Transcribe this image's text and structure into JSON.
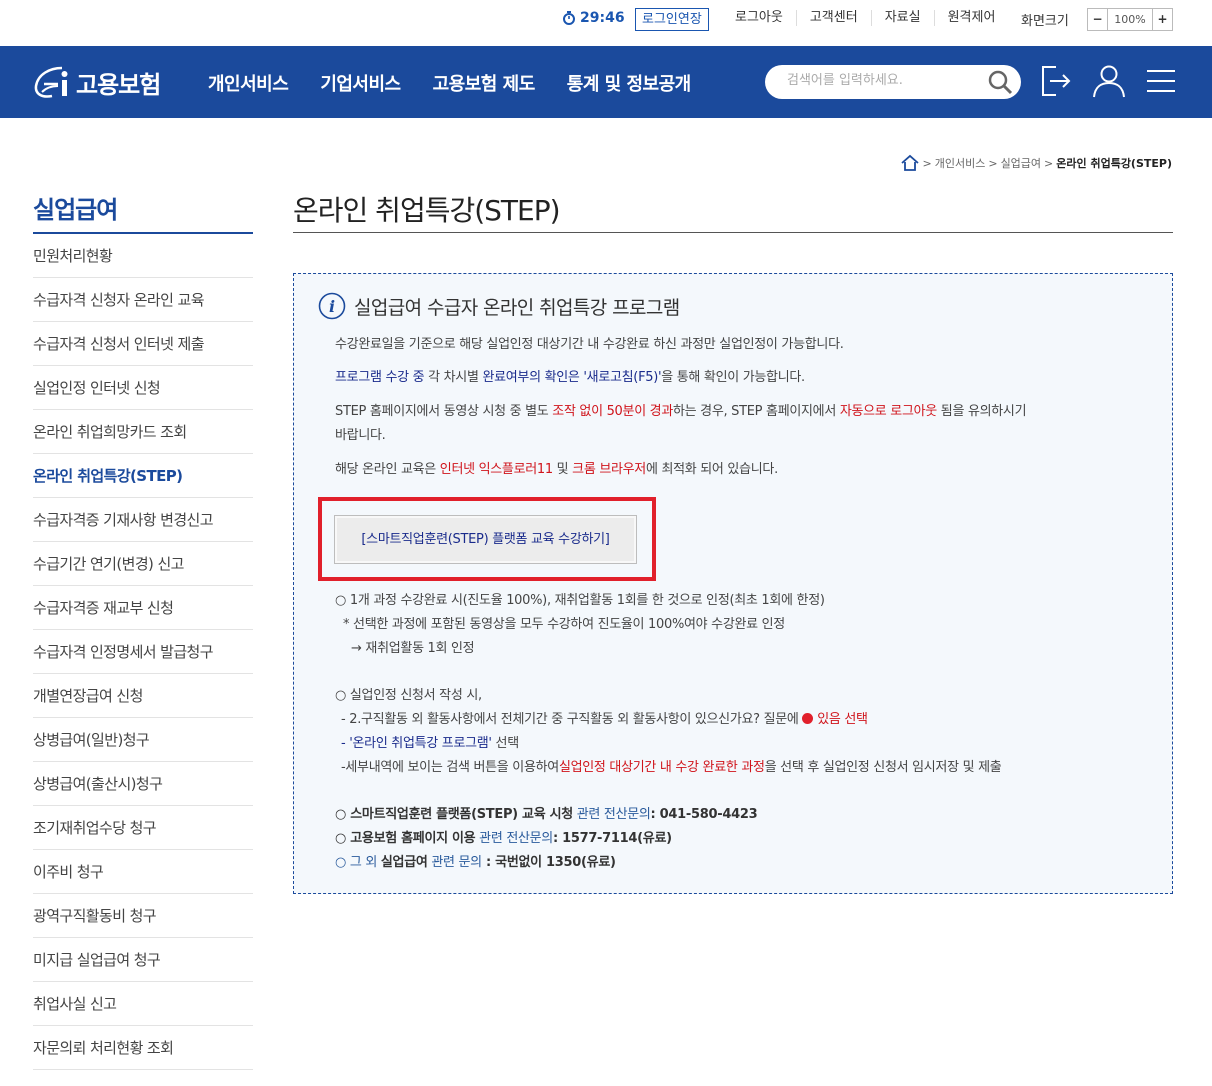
{
  "utility": {
    "timer": "29:46",
    "extend_label": "로그인연장",
    "links": [
      "로그아웃",
      "고객센터",
      "자료실",
      "원격제어"
    ],
    "zoom_label": "화면크기",
    "zoom_minus": "−",
    "zoom_value": "100%",
    "zoom_plus": "+"
  },
  "header": {
    "logo_text": "고용보험",
    "menu": [
      "개인서비스",
      "기업서비스",
      "고용보험 제도",
      "통계 및 정보공개"
    ],
    "search_placeholder": "검색어를 입력하세요."
  },
  "breadcrumb": {
    "items": [
      "개인서비스",
      "실업급여"
    ],
    "current": "온라인 취업특강(STEP)"
  },
  "sidebar": {
    "title": "실업급여",
    "items": [
      "민원처리현황",
      "수급자격 신청자 온라인 교육",
      "수급자격 신청서 인터넷 제출",
      "실업인정 인터넷 신청",
      "온라인 취업희망카드 조회",
      "온라인 취업특강(STEP)",
      "수급자격증 기재사항 변경신고",
      "수급기간 연기(변경) 신고",
      "수급자격증 재교부 신청",
      "수급자격 인정명세서 발급청구",
      "개별연장급여 신청",
      "상병급여(일반)청구",
      "상병급여(출산시)청구",
      "조기재취업수당 청구",
      "이주비 청구",
      "광역구직활동비 청구",
      "미지급 실업급여 청구",
      "취업사실 신고",
      "자문의뢰 처리현황 조회"
    ],
    "active_index": 5
  },
  "main": {
    "title": "온라인 취업특강(STEP)",
    "box_title": "실업급여 수급자 온라인 취업특강 프로그램",
    "line1": "수강완료일을 기준으로 해당 실업인정 대상기간 내 수강완료 하신 과정만 실업인정이 가능합니다.",
    "line2": {
      "a": "프로그램 수강 중",
      "b": " 각 차시별 ",
      "c": "완료여부의 확인은 '새로고침(F5)'",
      "d": "을 통해 확인이 가능합니다."
    },
    "line3": {
      "a": "STEP 홈페이지에서 동영상 시청 중 별도 ",
      "b": "조작 없이 50분이 경과",
      "c": "하는 경우, STEP 홈페이지에서 ",
      "d": "자동으로 로그아웃",
      "e": " 됨을 유의하시기",
      "f": "바랍니다."
    },
    "line4": {
      "a": "해당 온라인 교육은 ",
      "b": "인터넷 익스플로러11",
      "c": " 및 ",
      "d": "크롬 브라우저",
      "e": "에 최적화 되어 있습니다."
    },
    "step_button": "[스마트직업훈련(STEP) 플랫폼 교육 수강하기]",
    "complete": {
      "l1": "○ 1개 과정 수강완료 시(진도율 100%), 재취업활동 1회를 한 것으로 인정(최초 1회에 한정)",
      "l2": "* 선택한 과정에 포함된 동영상을 모두 수강하여 진도율이 100%여야 수강완료 인정",
      "l3": "→ 재취업활동 1회 인정"
    },
    "apply": {
      "l1": "○ 실업인정 신청서 작성 시,",
      "l2a": "- 2.구직활동 외 활동사항에서 전체기간 중 구직활동 외 활동사항이 있으신가요? 질문에 ",
      "l2b": " 있음 선택",
      "l3a": "- '온라인 취업특강 프로그램'",
      "l3b": " 선택",
      "l4a": "-세부내역에 보이는 검색 버튼을 이용하여",
      "l4b": "실업인정 대상기간 내 수강 완료한 과정",
      "l4c": "을 선택 후 실업인정 신청서 임시저장 및 제출"
    },
    "contacts": [
      {
        "a": "○ 스마트직업훈련 플랫폼(STEP) 교육 시청",
        "b": " 관련 전산문의",
        "c": ": 041-580-4423"
      },
      {
        "a": "○ 고용보험 홈페이지 이용",
        "b": " 관련 전산문의",
        "c": ": 1577-7114(유료)"
      },
      {
        "a": "○ 그 외 ",
        "a2": "실업급여",
        "b": " 관련 문의",
        "c": " : 국번없이 1350(유료)"
      }
    ]
  }
}
